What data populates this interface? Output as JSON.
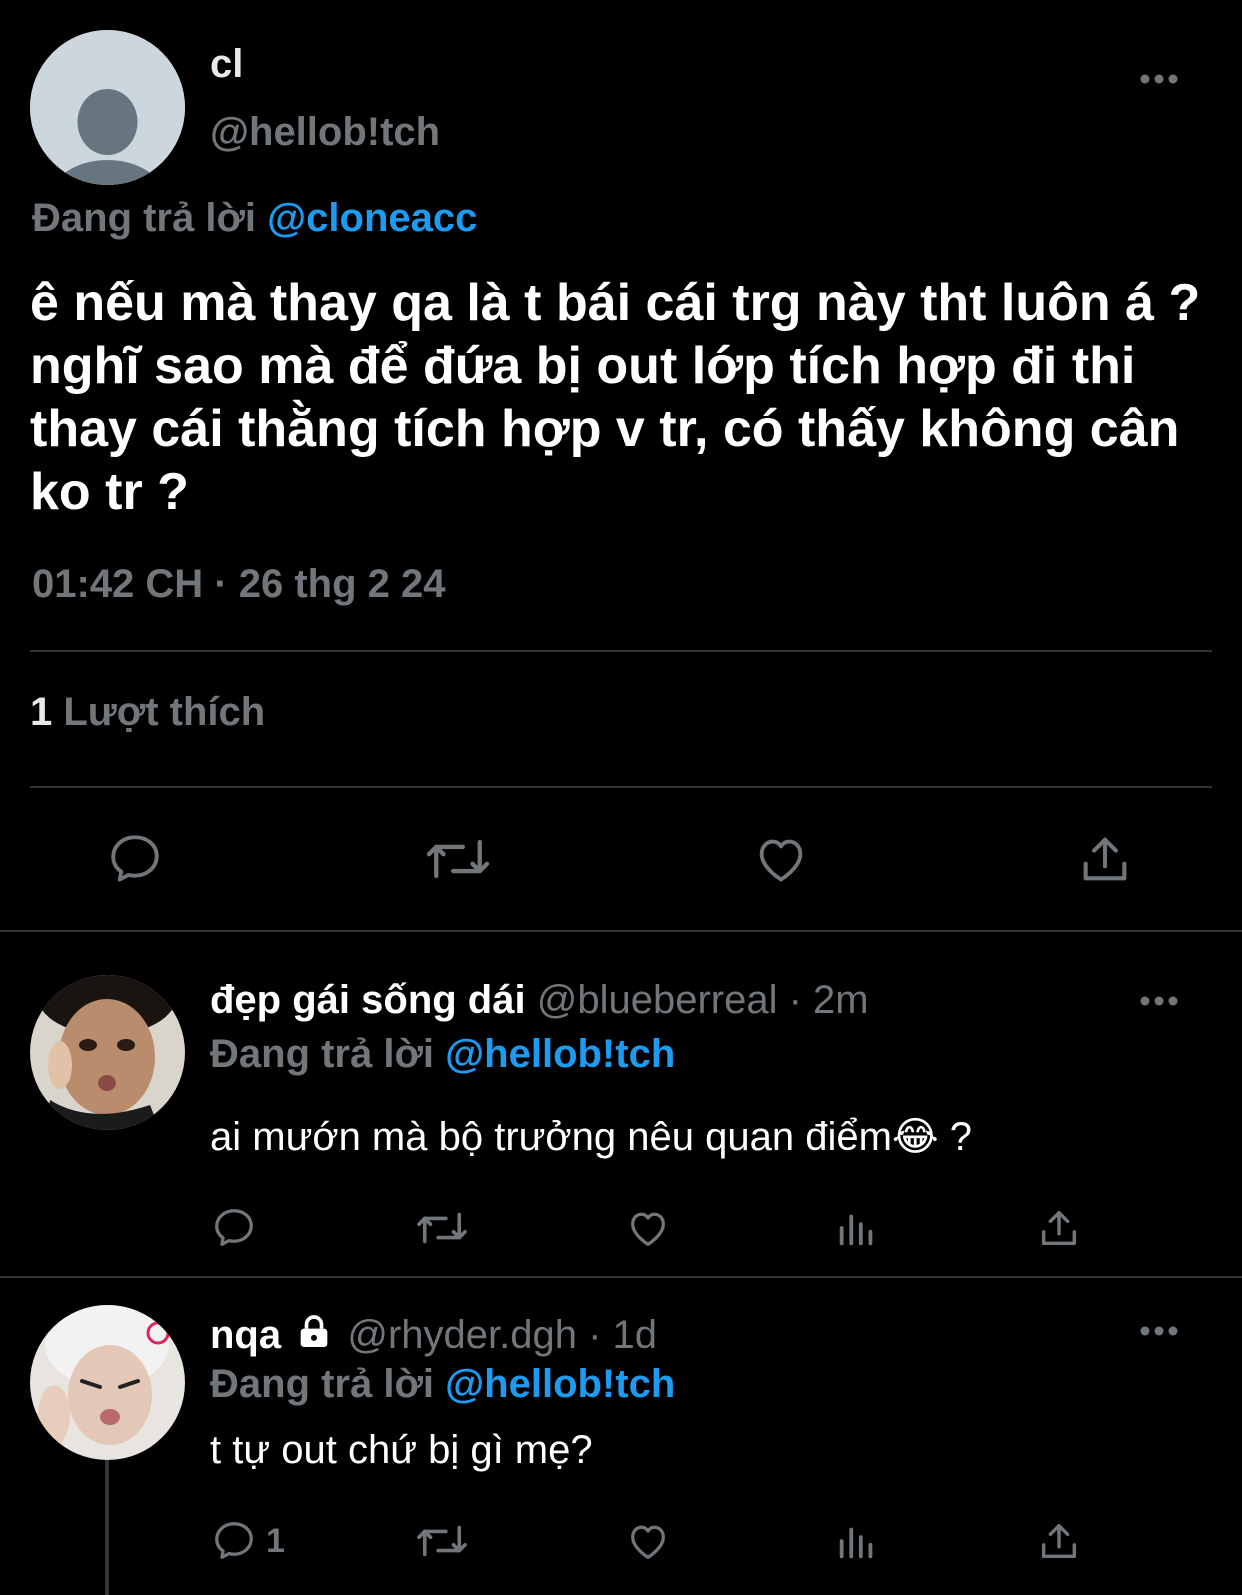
{
  "main_tweet": {
    "name": "cl",
    "handle": "@hellob!tch",
    "replying_prefix": "Đang trả lời",
    "replying_to": "@cloneacc",
    "text": "ê nếu mà thay qa là t bái cái trg này tht luôn á ? nghĩ sao mà để đứa bị out lớp tích hợp đi thi thay cái thằng tích hợp v tr, có thấy không cân ko tr ?",
    "timestamp": "01:42 CH · 26 thg 2 24",
    "likes_count": "1",
    "likes_label": "Lượt thích"
  },
  "replies": [
    {
      "name": "đẹp gái sống dái",
      "handle": "@blueberreal · 2m",
      "replying_prefix": "Đang trả lời",
      "replying_to": "@hellob!tch",
      "text": "ai mướn mà bộ trưởng nêu quan điểm😂 ?",
      "reply_count": ""
    },
    {
      "name": "nqa",
      "locked": true,
      "handle": "@rhyder.dgh · 1d",
      "replying_prefix": "Đang trả lời",
      "replying_to": "@hellob!tch",
      "text": "t tự out chứ bị gì mẹ?",
      "reply_count": "1"
    }
  ],
  "colors": {
    "background": "#000000",
    "text": "#e7e9ea",
    "secondary": "#71767b",
    "accent": "#1d9bf0",
    "divider": "#2f3336"
  },
  "icons": [
    "more-icon",
    "reply-icon",
    "retweet-icon",
    "like-icon",
    "share-icon",
    "views-icon",
    "lock-icon"
  ]
}
